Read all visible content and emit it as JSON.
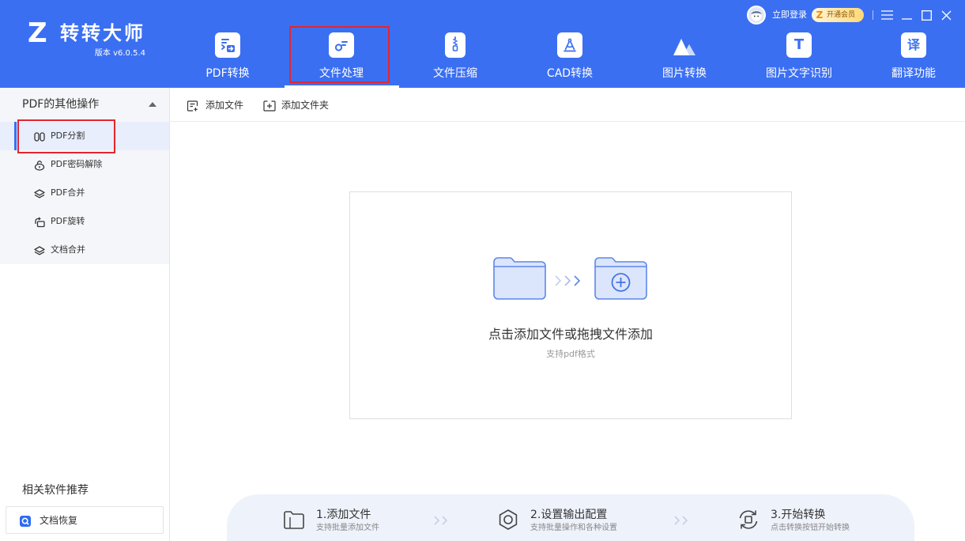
{
  "colors": {
    "primary": "#3b6ff2",
    "annotation": "#e3262e",
    "active_item_bg": "#e8eefc",
    "vip_badge": "#ffd877",
    "steps_panel": "#eef2fb"
  },
  "app": {
    "logo_mark": "Z",
    "name": "转转大师",
    "version": "版本 v6.0.5.4"
  },
  "account": {
    "avatar_icon": "user-avatar-icon",
    "login_label": "立即登录",
    "vip_mark": "Z",
    "vip_label": "开通会员"
  },
  "window_controls": [
    "menu-icon",
    "minimize-icon",
    "maximize-icon",
    "close-icon"
  ],
  "nav": {
    "active_index": 1,
    "tabs": [
      {
        "label": "PDF转换",
        "icon": "pdf-convert-icon"
      },
      {
        "label": "文件处理",
        "icon": "file-process-icon"
      },
      {
        "label": "文件压缩",
        "icon": "file-compress-icon"
      },
      {
        "label": "CAD转换",
        "icon": "cad-convert-icon"
      },
      {
        "label": "图片转换",
        "icon": "image-convert-icon"
      },
      {
        "label": "图片文字识别",
        "icon": "ocr-icon",
        "glyph": "T"
      },
      {
        "label": "翻译功能",
        "icon": "translate-icon",
        "glyph": "译"
      }
    ]
  },
  "sidebar": {
    "section_title": "PDF的其他操作",
    "expanded": true,
    "items": [
      {
        "label": "PDF分割",
        "icon": "split-icon",
        "active": true
      },
      {
        "label": "PDF密码解除",
        "icon": "unlock-icon",
        "active": false
      },
      {
        "label": "PDF合并",
        "icon": "merge-layers-icon",
        "active": false
      },
      {
        "label": "PDF旋转",
        "icon": "rotate-icon",
        "active": false
      },
      {
        "label": "文档合并",
        "icon": "merge-layers-icon",
        "active": false
      }
    ],
    "recommend_title": "相关软件推荐",
    "recommend_items": [
      {
        "label": "文档恢复",
        "icon": "recovery-app-icon"
      }
    ]
  },
  "toolbar": {
    "add_file_label": "添加文件",
    "add_folder_label": "添加文件夹"
  },
  "dropzone": {
    "title": "点击添加文件或拖拽文件添加",
    "subtitle": "支持pdf格式"
  },
  "steps": [
    {
      "title": "1.添加文件",
      "desc": "支持批量添加文件",
      "icon": "folder-outline-icon"
    },
    {
      "title": "2.设置输出配置",
      "desc": "支持批量操作和各种设置",
      "icon": "settings-ring-icon"
    },
    {
      "title": "3.开始转换",
      "desc": "点击转换按钮开始转换",
      "icon": "convert-cycle-icon"
    }
  ]
}
